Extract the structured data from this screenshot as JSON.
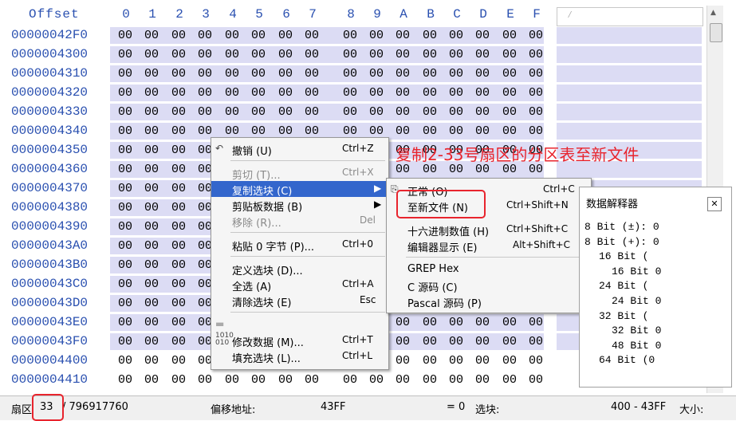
{
  "header": {
    "offset_label": "Offset",
    "columns": [
      "0",
      "1",
      "2",
      "3",
      "4",
      "5",
      "6",
      "7",
      "8",
      "9",
      "A",
      "B",
      "C",
      "D",
      "E",
      "F"
    ],
    "text_box_glyph": "⁄"
  },
  "rows": [
    {
      "offset": "00000042F0"
    },
    {
      "offset": "0000004300"
    },
    {
      "offset": "0000004310"
    },
    {
      "offset": "0000004320"
    },
    {
      "offset": "0000004330"
    },
    {
      "offset": "0000004340"
    },
    {
      "offset": "0000004350"
    },
    {
      "offset": "0000004360"
    },
    {
      "offset": "0000004370"
    },
    {
      "offset": "0000004380"
    },
    {
      "offset": "0000004390"
    },
    {
      "offset": "00000043A0"
    },
    {
      "offset": "00000043B0"
    },
    {
      "offset": "00000043C0"
    },
    {
      "offset": "00000043D0"
    },
    {
      "offset": "00000043E0"
    },
    {
      "offset": "00000043F0"
    },
    {
      "offset": "0000004400"
    },
    {
      "offset": "0000004410"
    }
  ],
  "hex_byte": "00",
  "context_menu": {
    "items": [
      {
        "label": "撤销 (U)",
        "shortcut": "Ctrl+Z",
        "disabled": false,
        "icon": "undo-icon"
      },
      {
        "label": "剪切 (T)...",
        "shortcut": "Ctrl+X",
        "disabled": true
      },
      {
        "label": "复制选块 (C)",
        "shortcut": "",
        "highlighted": true,
        "submenu": true
      },
      {
        "label": "剪贴板数据 (B)",
        "shortcut": "",
        "submenu": true
      },
      {
        "label": "移除 (R)...",
        "shortcut": "Del",
        "disabled": true
      },
      {
        "label": "粘贴 0 字节 (P)...",
        "shortcut": "Ctrl+0"
      },
      {
        "label": "定义选块 (D)...",
        "shortcut": ""
      },
      {
        "label": "全选 (A)",
        "shortcut": "Ctrl+A"
      },
      {
        "label": "清除选块 (E)",
        "shortcut": "Esc"
      },
      {
        "label": "修改数据 (M)...",
        "shortcut": "Ctrl+T",
        "icon": "binary-icon"
      },
      {
        "label": "填充选块 (L)...",
        "shortcut": "Ctrl+L"
      }
    ]
  },
  "submenu": {
    "items": [
      {
        "label": "正常 (O)",
        "shortcut": "Ctrl+C",
        "icon": "copy-icon"
      },
      {
        "label": "至新文件 (N)",
        "shortcut": "Ctrl+Shift+N"
      },
      {
        "label": "十六进制数值 (H)",
        "shortcut": "Ctrl+Shift+C"
      },
      {
        "label": "编辑器显示 (E)",
        "shortcut": "Alt+Shift+C"
      },
      {
        "label": "GREP Hex",
        "shortcut": ""
      },
      {
        "label": "C 源码 (C)",
        "shortcut": ""
      },
      {
        "label": "Pascal 源码 (P)",
        "shortcut": ""
      }
    ]
  },
  "annotation": "复制2-33号扇区的分区表至新文件",
  "interpreter": {
    "title": "数据解释器",
    "close": "✕",
    "lines": [
      "8 Bit (±): 0",
      "8 Bit (+): 0",
      "16 Bit (",
      "16 Bit 0",
      "24 Bit (",
      "24 Bit 0",
      "32 Bit (",
      "32 Bit 0",
      "48 Bit 0",
      "64 Bit (0"
    ]
  },
  "status": {
    "sector_label": "扇区",
    "sector_value": "33",
    "total": "/ 796917760",
    "offset_label": "偏移地址:",
    "offset_value": "43FF",
    "eq_value": "= 0",
    "block_label": "选块:",
    "block_value": "400 - 43FF",
    "size_label": "大小:"
  },
  "colors": {
    "accent": "#2a50b0",
    "highlight": "#3366cc",
    "annotation": "#e8242d",
    "hexbg": "#dcdcf4"
  }
}
